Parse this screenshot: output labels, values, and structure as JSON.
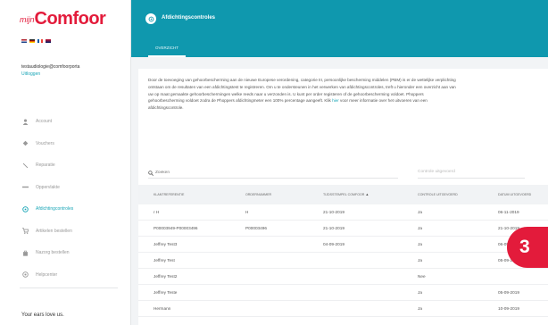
{
  "brand": {
    "logo_prefix": "mijn",
    "logo_main": "Comfoor",
    "color": "#e31b3b"
  },
  "languages": [
    {
      "name": "nl",
      "colors": [
        "#ae1c28",
        "#21468b"
      ]
    },
    {
      "name": "de",
      "colors": [
        "#222222",
        "#dd0000"
      ]
    },
    {
      "name": "fr",
      "colors": [
        "#0055a4",
        "#ef4135"
      ]
    },
    {
      "name": "en",
      "colors": [
        "#012169",
        "#c8102e"
      ]
    }
  ],
  "user": {
    "email": "testaudiologie@comfoorporta",
    "logout_label": "Uitloggen"
  },
  "sidebar": {
    "items": [
      {
        "label": "Account",
        "icon": "person-icon",
        "active": false
      },
      {
        "label": "Vouchers",
        "icon": "voucher-icon",
        "active": false
      },
      {
        "label": "Reparatie",
        "icon": "wrench-icon",
        "active": false
      },
      {
        "label": "Oppervlakte",
        "icon": "ruler-icon",
        "active": false
      },
      {
        "label": "Afdichtingcontroles",
        "icon": "ear-icon",
        "active": true
      },
      {
        "label": "Artikelen bestellen",
        "icon": "cart-icon",
        "active": false
      },
      {
        "label": "Nazorg bestellen",
        "icon": "bag-icon",
        "active": false
      },
      {
        "label": "Helpcenter",
        "icon": "help-icon",
        "active": false
      }
    ],
    "tagline": "Your ears love us."
  },
  "header": {
    "title": "Afdichtingscontroles",
    "accent": "#0f98ae",
    "tabs": [
      {
        "label": "OVERZICHT",
        "active": true
      }
    ]
  },
  "intro": {
    "text_before": "Door de toevoeging van gehoorbescherming aan de nieuwe Europese verordening, categorie III, persoonlijke bescherming middelen (PBM) is er de wettelijke verplichting ontstaan om de resultaten van een afdichtingstest te registreren. Om u te ondersteunen in het verwerken van afdichtingscontroles, treft u hieronder een overzicht aan van uw op maat gemaakte gehoorbeschermingen welke reeds naar u verzonden is. U kunt per order registeren of de gehoorbescherming voldoet. Phoppers gehoorbescherming voldoet zodra de Phoppers afdichtingmeter een 100% percentage aangeeft. Klik",
    "link": "hier",
    "text_after": "voor meer informatie over het uitvoeren van een afdichtingscontrole."
  },
  "search": {
    "placeholder": "Zoeken",
    "value": ""
  },
  "filter": {
    "label": "Controle uitgevoerd"
  },
  "table": {
    "columns": [
      {
        "label": "KLANTREFERENTIE",
        "sort": ""
      },
      {
        "label": "ORDERNUMMER",
        "sort": ""
      },
      {
        "label": "TIJDSSTEMPEL COMFOOR",
        "sort": "▲"
      },
      {
        "label": "CONTROLE UITGEVOERD",
        "sort": ""
      },
      {
        "label": "DATUM UITGEVOERD",
        "sort": ""
      }
    ],
    "rows": [
      [
        "r H",
        "H",
        "21-10-2019",
        "Ja",
        "06-11-2019"
      ],
      [
        "P00003949-P00003496",
        "P00003496",
        "21-10-2019",
        "Ja",
        "21-10-2019"
      ],
      [
        "Jeffrey Test3",
        "",
        "04-09-2019",
        "Ja",
        "06-09-2019"
      ],
      [
        "Jeffrey Test",
        "",
        "",
        "Ja",
        "05-09-2019"
      ],
      [
        "Jeffrey Test2",
        "",
        "",
        "Nee",
        ""
      ],
      [
        "Jeffrey Teste",
        "",
        "",
        "Ja",
        "05-09-2019"
      ],
      [
        "Hermann",
        "",
        "",
        "Ja",
        "10-09-2019"
      ]
    ]
  },
  "badge": {
    "number": "3"
  }
}
